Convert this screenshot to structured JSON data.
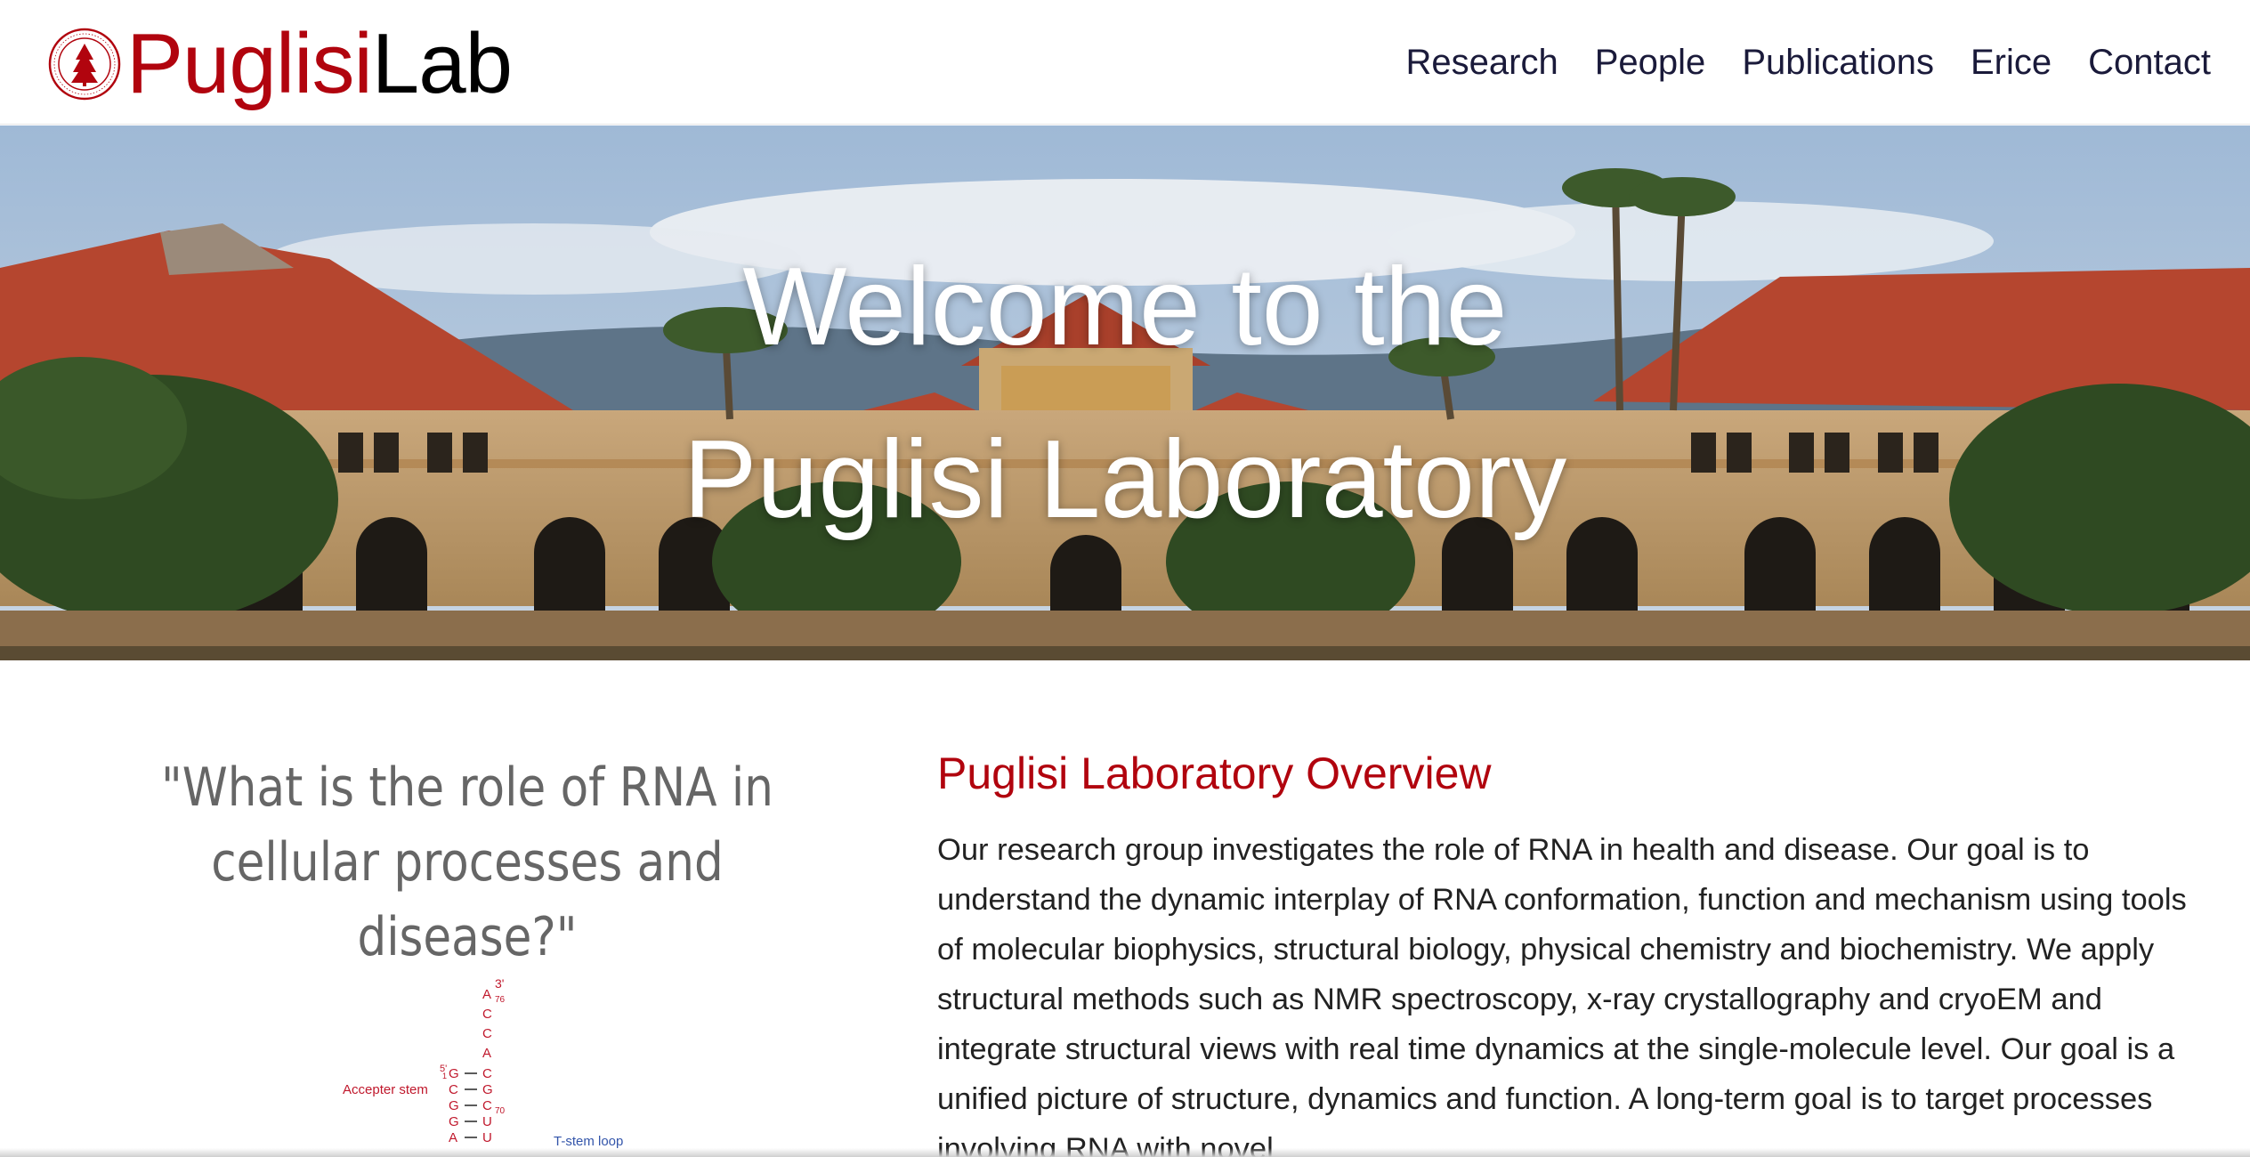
{
  "header": {
    "brand_primary": "Puglisi",
    "brand_secondary": "Lab",
    "logo_icon": "stanford-seal-icon",
    "nav": [
      {
        "label": "Research"
      },
      {
        "label": "People"
      },
      {
        "label": "Publications"
      },
      {
        "label": "Erice"
      },
      {
        "label": "Contact"
      }
    ]
  },
  "hero": {
    "line1": "Welcome to the",
    "line2": "Puglisi Laboratory"
  },
  "quote": {
    "text": "\"What is the role of RNA in cellular processes and disease?\""
  },
  "diagram": {
    "label_accepter": "Accepter stem",
    "label_tstem": "T-stem loop",
    "three_prime": "3'",
    "five_prime": "5'",
    "pos_76": "76",
    "pos_1": "1",
    "pos_70": "70",
    "strand_top": [
      "A",
      "C",
      "C",
      "A"
    ],
    "left_strand": [
      "G",
      "C",
      "G",
      "G",
      "A"
    ],
    "right_strand": [
      "C",
      "G",
      "C",
      "U",
      "U"
    ]
  },
  "overview": {
    "title": "Puglisi Laboratory Overview",
    "body": "Our research group investigates the role of RNA in health and disease. Our goal is to understand the dynamic interplay of RNA conformation, function and mechanism using tools of molecular biophysics, structural biology, physical chemistry and biochemistry. We apply structural methods such as NMR spectroscopy, x-ray crystallography and cryoEM and integrate structural views with real time dynamics at the single-molecule level. Our goal is a unified picture of structure, dynamics and function. A long-term goal is to target processes involving RNA with novel"
  },
  "colors": {
    "brand_red": "#b1040e",
    "nav_text": "#1a1a3a",
    "quote_gray": "#666666"
  }
}
